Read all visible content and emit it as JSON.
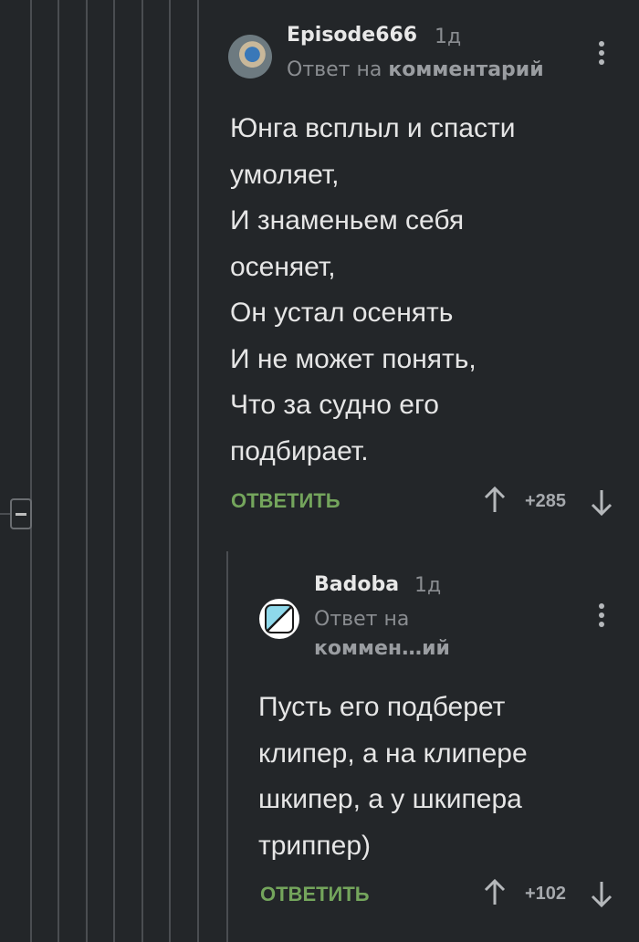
{
  "comments": [
    {
      "username": "Episode666",
      "time": "1д",
      "reply_prefix": "Ответ на ",
      "reply_target": "комментарий",
      "body": "Юнга всплыл и спасти\nумоляет,\nИ знаменьем себя\nосеняет,\nОн устал осенять\nИ не может понять,\nЧто за судно его\nподбирает.",
      "reply_label": "ОТВЕТИТЬ",
      "score": "+285"
    },
    {
      "username": "Badoba",
      "time": "1д",
      "reply_prefix": "Ответ на",
      "reply_target": "коммен…ий",
      "body": "Пусть его подберет\nклипер, а на клипере\nшкипер, а у шкипера\nтриппер)",
      "reply_label": "ОТВЕТИТЬ",
      "score": "+102"
    }
  ],
  "icons": {
    "collapse": "minus-square-icon",
    "more": "more-vertical-icon",
    "upvote": "arrow-up-icon",
    "downvote": "arrow-down-icon"
  },
  "colors": {
    "background": "#232629",
    "accent_reply": "#74a55c",
    "thread_line": "#4a4d51"
  }
}
